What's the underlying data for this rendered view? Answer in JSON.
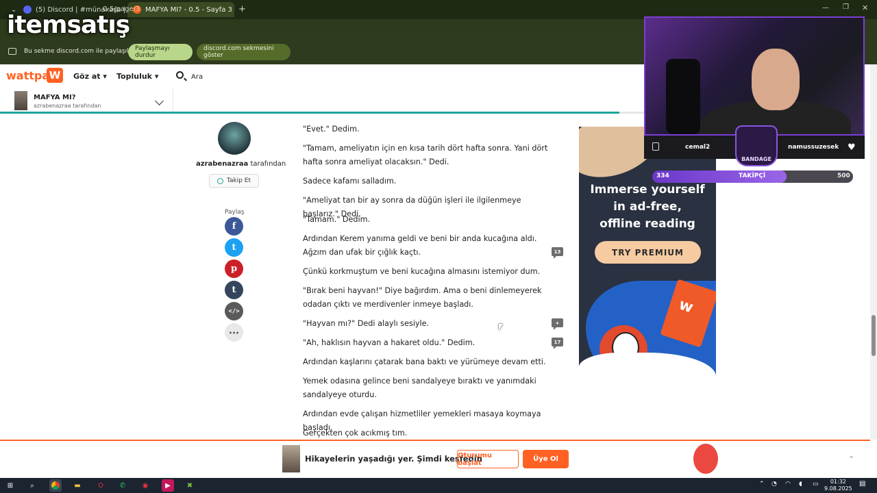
{
  "browser": {
    "tabs": [
      {
        "title": "(5) Discord | #münakaşa | E"
      },
      {
        "title": "MAFYA MI? - 0.5 - Sayfa 3"
      }
    ],
    "url_fragment": "0-5/page/3",
    "overlay_logo_text": "itemsatış"
  },
  "share_bar": {
    "message": "Bu sekme discord.com ile paylaşılıyor",
    "stop_label": "Paylaşmayı durdur",
    "show_label": "discord.com sekmesini göster"
  },
  "header": {
    "logo": "wattpad",
    "logo_mark": "W",
    "browse_label": "Göz at ▾",
    "community_label": "Topluluk ▾",
    "search_label": "Ara"
  },
  "story": {
    "title": "MAFYA MI?",
    "author_line": "azrabenazraa tarafından"
  },
  "author": {
    "name": "azrabenazraa",
    "suffix": " tarafından",
    "follow_label": "Takip Et",
    "share_label": "Paylaş"
  },
  "share_icons": [
    {
      "name": "facebook-icon",
      "glyph": "f",
      "color": "#3b5998"
    },
    {
      "name": "twitter-icon",
      "glyph": "t",
      "color": "#1da1f2"
    },
    {
      "name": "pinterest-icon",
      "glyph": "p",
      "color": "#cb2027"
    },
    {
      "name": "tumblr-icon",
      "glyph": "t",
      "color": "#35465c"
    },
    {
      "name": "embed-icon",
      "glyph": "</>",
      "color": "#5a5a5a"
    },
    {
      "name": "more-icon",
      "glyph": "•••",
      "color": "#e8e8e8"
    }
  ],
  "paragraphs": [
    "\"Evet.\" Dedim.",
    "\"Tamam, ameliyatın için en kısa tarih dört hafta sonra. Yani dört hafta sonra ameliyat olacaksın.\" Dedi.",
    "Sadece kafamı salladım.",
    "\"Ameliyat tan bir ay sonra da düğün işleri ile ilgilenmeye başlarız.\" Dedi.",
    "\"Tamam.\" Dedim.",
    "Ardından Kerem yanıma geldi ve beni bir anda kucağına aldı. Ağzım dan ufak bir çığlık kaçtı.",
    "Çünkü korkmuştum ve beni kucağına almasını istemiyor dum.",
    "\"Bırak beni hayvan!\" Diye bağırdım. Ama o beni dinlemeyerek odadan çıktı ve merdivenler inmeye başladı.",
    "\"Hayvan mı?\" Dedi alaylı sesiyle.",
    "\"Ah, haklısın hayvan a hakaret oldu.\" Dedim.",
    "Ardından kaşlarını çatarak bana baktı ve yürümeye devam etti.",
    "Yemek odasına gelince beni sandalyeye bıraktı ve yanımdaki sandalyeye oturdu.",
    "Ardından evde çalışan hizmetliler yemekleri masaya koymaya başladı.",
    "Gerçekten çok acıkmış tım."
  ],
  "comments": [
    {
      "count": "13"
    },
    {
      "count": "+"
    },
    {
      "count": "17"
    }
  ],
  "ad": {
    "headline_1": "Immerse yourself",
    "headline_2": "in ad-free,",
    "headline_3": "offline reading",
    "cta": "TRY PREMIUM",
    "card_mark": "w"
  },
  "stream": {
    "left_user": "cemal2",
    "right_user": "namussuzesek",
    "badge": "BANDAGE",
    "followers_current": "334",
    "followers_label": "TAKİPÇİ",
    "followers_goal": "500",
    "followers_progress": 0.668
  },
  "banner": {
    "text": "Hikayelerin yaşadığı yer. Şimdi keşfedin",
    "start_label": "Oturumu başlat",
    "join_label": "Üye Ol"
  },
  "taskbar": {
    "time": "01:32",
    "date": "9.08.2025"
  }
}
